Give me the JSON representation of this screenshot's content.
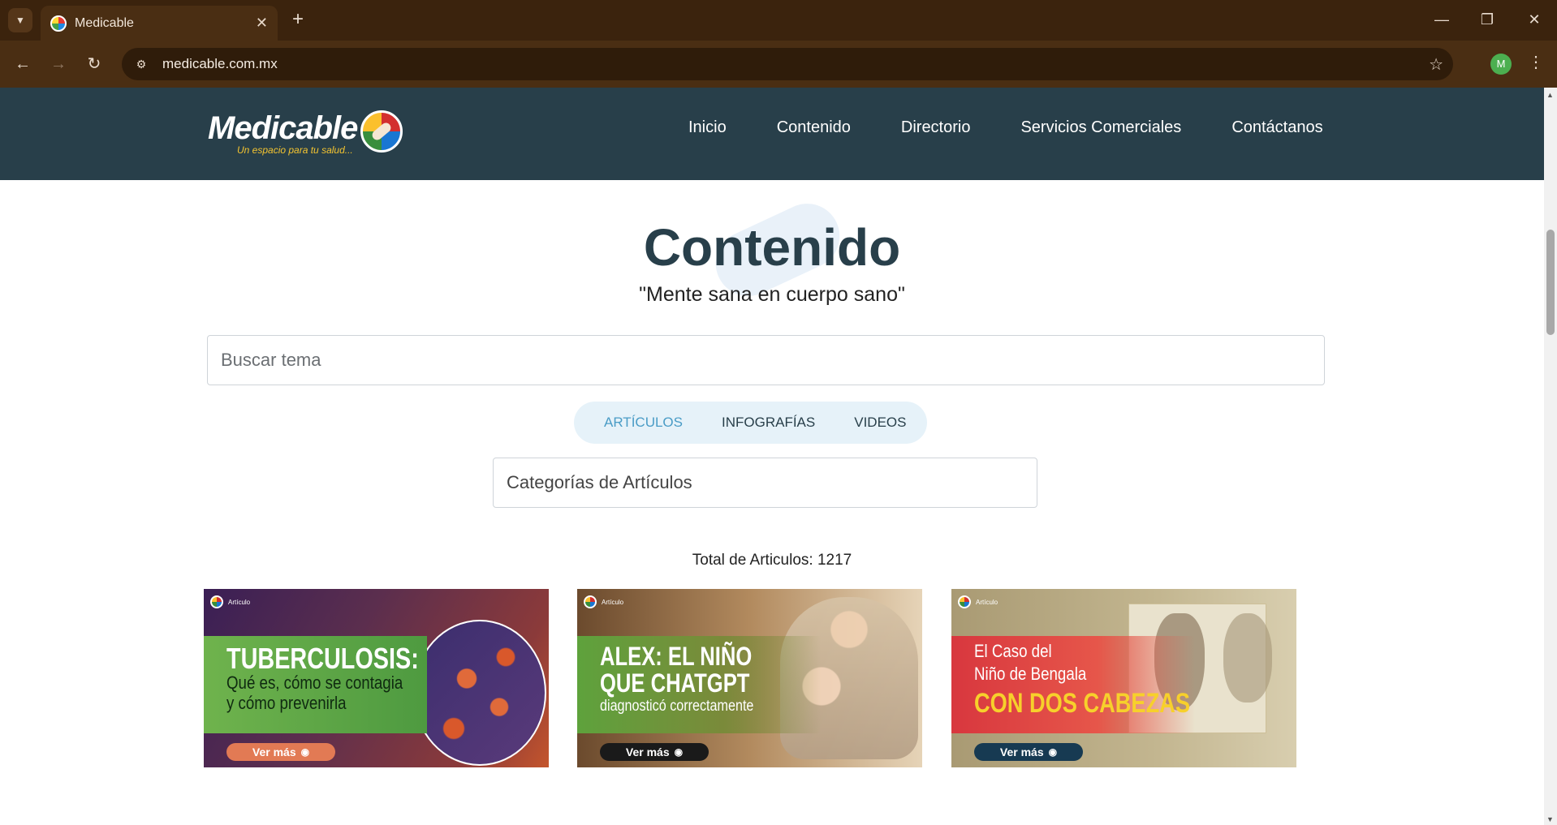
{
  "browser": {
    "tab_title": "Medicable",
    "tab_close": "✕",
    "new_tab": "+",
    "url": "medicable.com.mx",
    "profile_initial": "M",
    "controls": {
      "minimize": "—",
      "restore": "❐",
      "close": "✕"
    }
  },
  "site": {
    "logo_text": "Medicable",
    "logo_tagline": "Un espacio para tu salud...",
    "nav": [
      "Inicio",
      "Contenido",
      "Directorio",
      "Servicios Comerciales",
      "Contáctanos"
    ]
  },
  "page": {
    "title": "Contenido",
    "subtitle": "\"Mente sana en cuerpo sano\"",
    "search_placeholder": "Buscar tema",
    "tabs": [
      "ARTÍCULOS",
      "INFOGRAFÍAS",
      "VIDEOS"
    ],
    "active_tab": "ARTÍCULOS",
    "category_select": "Categorías de Artículos",
    "total": "Total de Articulos: 1217"
  },
  "cards": [
    {
      "tag": "Artículo",
      "line1": "TUBERCULOSIS:",
      "line2": "Qué es, cómo se contagia",
      "line3": "y cómo prevenirla",
      "button": "Ver más"
    },
    {
      "tag": "Artículo",
      "line1": "ALEX: EL NIÑO",
      "line2": "QUE CHATGPT",
      "line3": "diagnosticó correctamente",
      "button": "Ver más"
    },
    {
      "tag": "Artículo",
      "line1": "El Caso del",
      "line2": "Niño de Bengala",
      "line3": "CON DOS CABEZAS",
      "button": "Ver más"
    }
  ],
  "colors": {
    "header_bg": "#283f4a",
    "accent_tab": "#4a9cc6",
    "chrome_bg": "#3b230d"
  }
}
